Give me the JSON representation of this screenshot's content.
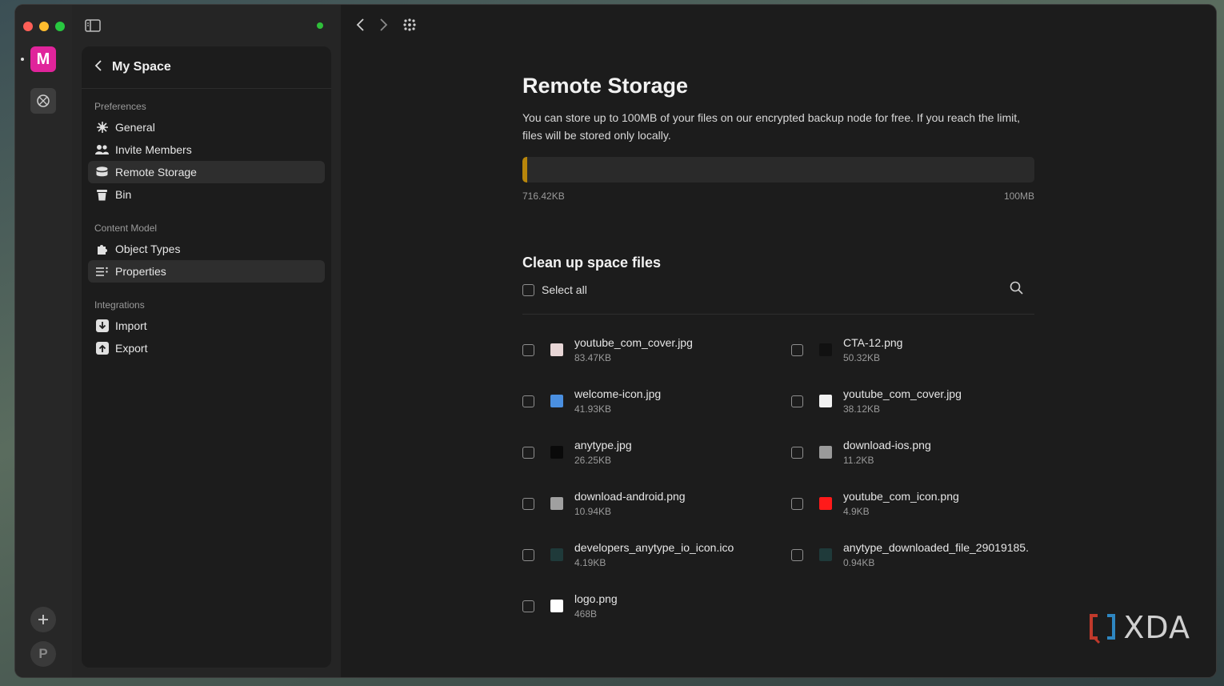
{
  "colors": {
    "accent_space": "#e0249b",
    "usage_fill": "#b8860b",
    "status_online": "#2fbf3a"
  },
  "rail": {
    "space_initial": "M",
    "profile_initial": "P"
  },
  "sidebar": {
    "title": "My Space",
    "sections": [
      {
        "title": "Preferences",
        "items": [
          {
            "label": "General",
            "icon": "gear-icon"
          },
          {
            "label": "Invite Members",
            "icon": "people-icon"
          },
          {
            "label": "Remote Storage",
            "icon": "database-icon"
          },
          {
            "label": "Bin",
            "icon": "bin-icon"
          }
        ]
      },
      {
        "title": "Content Model",
        "items": [
          {
            "label": "Object Types",
            "icon": "puzzle-icon"
          },
          {
            "label": "Properties",
            "icon": "list-icon"
          }
        ]
      },
      {
        "title": "Integrations",
        "items": [
          {
            "label": "Import",
            "icon": "import-icon"
          },
          {
            "label": "Export",
            "icon": "export-icon"
          }
        ]
      }
    ]
  },
  "main": {
    "title": "Remote Storage",
    "description": "You can store up to 100MB of your files on our encrypted backup node for free. If you reach the limit, files will be stored only locally.",
    "usage": {
      "used_label": "716.42KB",
      "limit_label": "100MB",
      "fraction": 0.007
    },
    "cleanup": {
      "title": "Clean up space files",
      "select_all": "Select all"
    },
    "files": [
      {
        "name": "youtube_com_cover.jpg",
        "size": "83.47KB",
        "thumb": "#e8d6d6"
      },
      {
        "name": "CTA-12.png",
        "size": "50.32KB",
        "thumb": "#111111"
      },
      {
        "name": "welcome-icon.jpg",
        "size": "41.93KB",
        "thumb": "#4a8fe0"
      },
      {
        "name": "youtube_com_cover.jpg",
        "size": "38.12KB",
        "thumb": "#f2f2f2"
      },
      {
        "name": "anytype.jpg",
        "size": "26.25KB",
        "thumb": "#0a0a0a"
      },
      {
        "name": "download-ios.png",
        "size": "11.2KB",
        "thumb": "#9a9a9a"
      },
      {
        "name": "download-android.png",
        "size": "10.94KB",
        "thumb": "#a0a0a0"
      },
      {
        "name": "youtube_com_icon.png",
        "size": "4.9KB",
        "thumb": "#ff1a1a"
      },
      {
        "name": "developers_anytype_io_icon.ico",
        "size": "4.19KB",
        "thumb": "#1f3a3a"
      },
      {
        "name": "anytype_downloaded_file_29019185.",
        "size": "0.94KB",
        "thumb": "#1f3a3a"
      },
      {
        "name": "logo.png",
        "size": "468B",
        "thumb": "#ffffff"
      }
    ]
  },
  "watermark": "XDA"
}
